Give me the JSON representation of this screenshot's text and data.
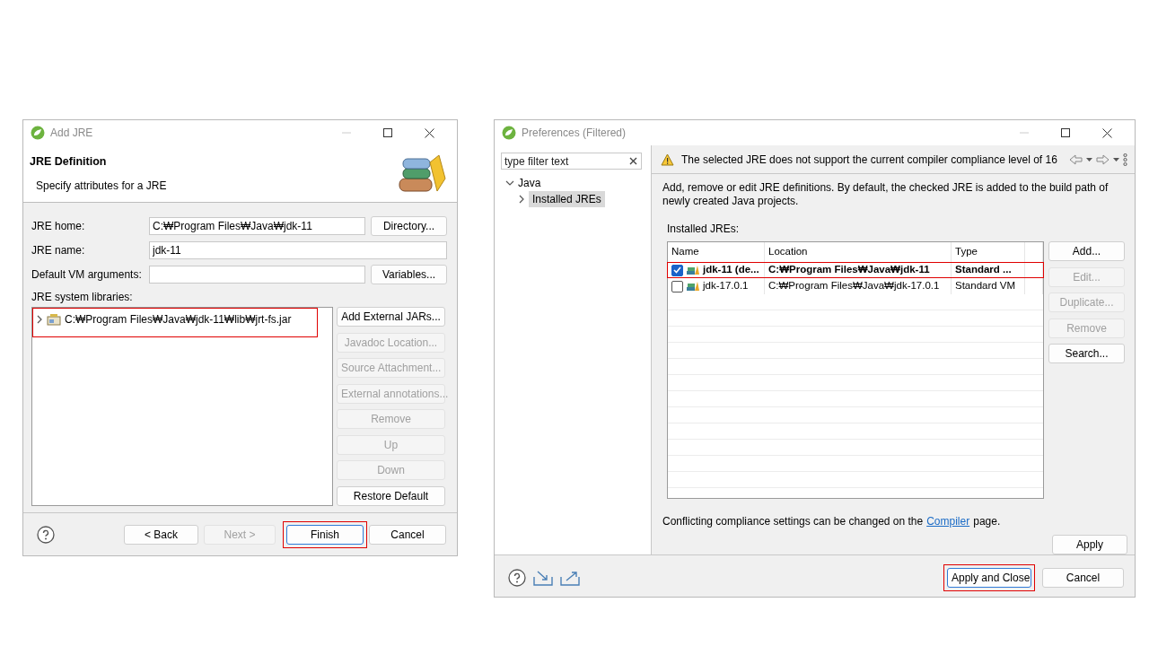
{
  "add_jre_window": {
    "title": "Add JRE",
    "header": {
      "title": "JRE Definition",
      "subtitle": "Specify attributes for a JRE"
    },
    "fields": [
      {
        "label": "JRE home:",
        "value": "C:₩Program Files₩Java₩jdk-11",
        "button": "Directory..."
      },
      {
        "label": "JRE name:",
        "value": "jdk-11"
      },
      {
        "label": "Default VM arguments:",
        "button": "Variables..."
      }
    ],
    "libraries_label": "JRE system libraries:",
    "libraries": [
      {
        "label": "C:₩Program Files₩Java₩jdk-11₩lib₩jrt-fs.jar",
        "expanded": false,
        "highlighted": true
      }
    ],
    "side_buttons": [
      {
        "label": "Add External JARs...",
        "disabled": false
      },
      {
        "label": "Javadoc Location...",
        "disabled": true
      },
      {
        "label": "Source Attachment...",
        "disabled": true
      },
      {
        "label": "External annotations...",
        "disabled": true
      },
      {
        "label": "Remove",
        "disabled": true
      },
      {
        "label": "Up",
        "disabled": true
      },
      {
        "label": "Down",
        "disabled": true
      },
      {
        "label": "Restore Default",
        "disabled": false
      }
    ],
    "footer_buttons": [
      {
        "label": "< Back",
        "disabled": false,
        "default": false,
        "highlighted": false
      },
      {
        "label": "Next >",
        "disabled": true,
        "default": false,
        "highlighted": false
      },
      {
        "label": "Finish",
        "disabled": false,
        "default": true,
        "highlighted": true
      },
      {
        "label": "Cancel",
        "disabled": false,
        "default": false,
        "highlighted": false
      }
    ]
  },
  "preferences_window": {
    "title": "Preferences (Filtered)",
    "filter": {
      "placeholder": "type filter text"
    },
    "tree": [
      {
        "label": "Java",
        "expanded": true,
        "selected": false,
        "children": [
          {
            "label": "Installed JREs",
            "expanded": false,
            "selected": true
          }
        ]
      }
    ],
    "warning": "The selected JRE does not support the current compiler compliance level of 16",
    "description": "Add, remove or edit JRE definitions. By default, the checked JRE is added to the build path of newly created Java projects.",
    "table_label": "Installed JREs:",
    "table": {
      "columns": [
        "Name",
        "Location",
        "Type"
      ],
      "rows": [
        {
          "checked": true,
          "default": true,
          "highlighted": true,
          "cells": [
            "jdk-11 (de...",
            "C:₩Program Files₩Java₩jdk-11",
            "Standard ..."
          ]
        },
        {
          "checked": false,
          "default": false,
          "highlighted": false,
          "cells": [
            "jdk-17.0.1",
            "C:₩Program Files₩Java₩jdk-17.0.1",
            "Standard VM"
          ]
        }
      ]
    },
    "side_buttons": [
      {
        "label": "Add...",
        "disabled": false
      },
      {
        "label": "Edit...",
        "disabled": true
      },
      {
        "label": "Duplicate...",
        "disabled": true
      },
      {
        "label": "Remove",
        "disabled": true
      },
      {
        "label": "Search...",
        "disabled": false
      }
    ],
    "note": {
      "before": "Conflicting compliance settings can be changed on the",
      "link": "Compiler",
      "after": "page."
    },
    "apply_button": "Apply",
    "footer_buttons": [
      {
        "label": "Apply and Close",
        "disabled": false,
        "default": true,
        "highlighted": true
      },
      {
        "label": "Cancel",
        "disabled": false,
        "default": false,
        "highlighted": false
      }
    ]
  }
}
